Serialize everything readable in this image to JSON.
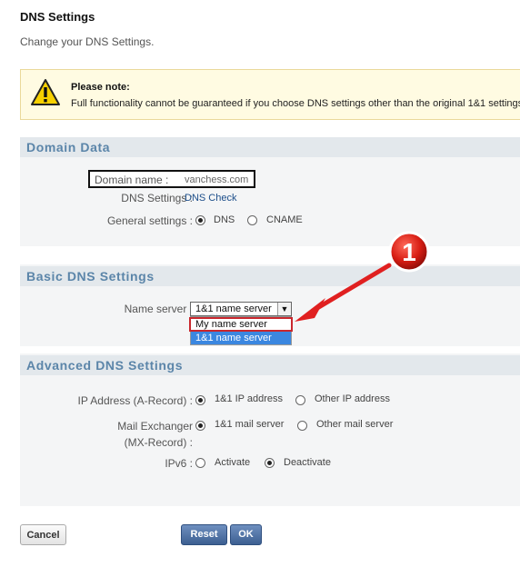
{
  "page": {
    "title": "DNS Settings",
    "subtitle": "Change your DNS Settings."
  },
  "note": {
    "title": "Please note:",
    "text": "Full functionality cannot be guaranteed if you choose DNS settings other than the original 1&1 settings,"
  },
  "domain_data": {
    "heading": "Domain Data",
    "domain_name_label": "Domain name :",
    "domain_name_value": "vanchess.com",
    "dns_settings_label": "DNS Settings :",
    "dns_check_link": "DNS Check",
    "general_settings_label": "General settings :",
    "options": [
      {
        "label": "DNS",
        "selected": true
      },
      {
        "label": "CNAME",
        "selected": false
      }
    ]
  },
  "basic_dns": {
    "heading": "Basic DNS Settings",
    "name_server_label": "Name server :",
    "selected_value": "1&1 name server",
    "dropdown_options": [
      "My name server",
      "1&1 name server"
    ],
    "callout_number": "1"
  },
  "advanced_dns": {
    "heading": "Advanced DNS Settings",
    "ip_label": "IP Address (A-Record) :",
    "ip_options": [
      {
        "label": "1&1 IP address",
        "selected": true
      },
      {
        "label": "Other IP address",
        "selected": false
      }
    ],
    "mx_label_line1": "Mail Exchanger",
    "mx_label_line2": "(MX-Record) :",
    "mx_options": [
      {
        "label": "1&1 mail server",
        "selected": true
      },
      {
        "label": "Other mail server",
        "selected": false
      }
    ],
    "ipv6_label": "IPv6 :",
    "ipv6_options": [
      {
        "label": "Activate",
        "selected": false
      },
      {
        "label": "Deactivate",
        "selected": true
      }
    ]
  },
  "buttons": {
    "cancel": "Cancel",
    "reset": "Reset",
    "ok": "OK"
  },
  "colors": {
    "section_heading": "#5b85a9",
    "primary_button": "#3c5f91",
    "highlight_red": "#e02020",
    "dropdown_selected": "#3b87e0"
  }
}
